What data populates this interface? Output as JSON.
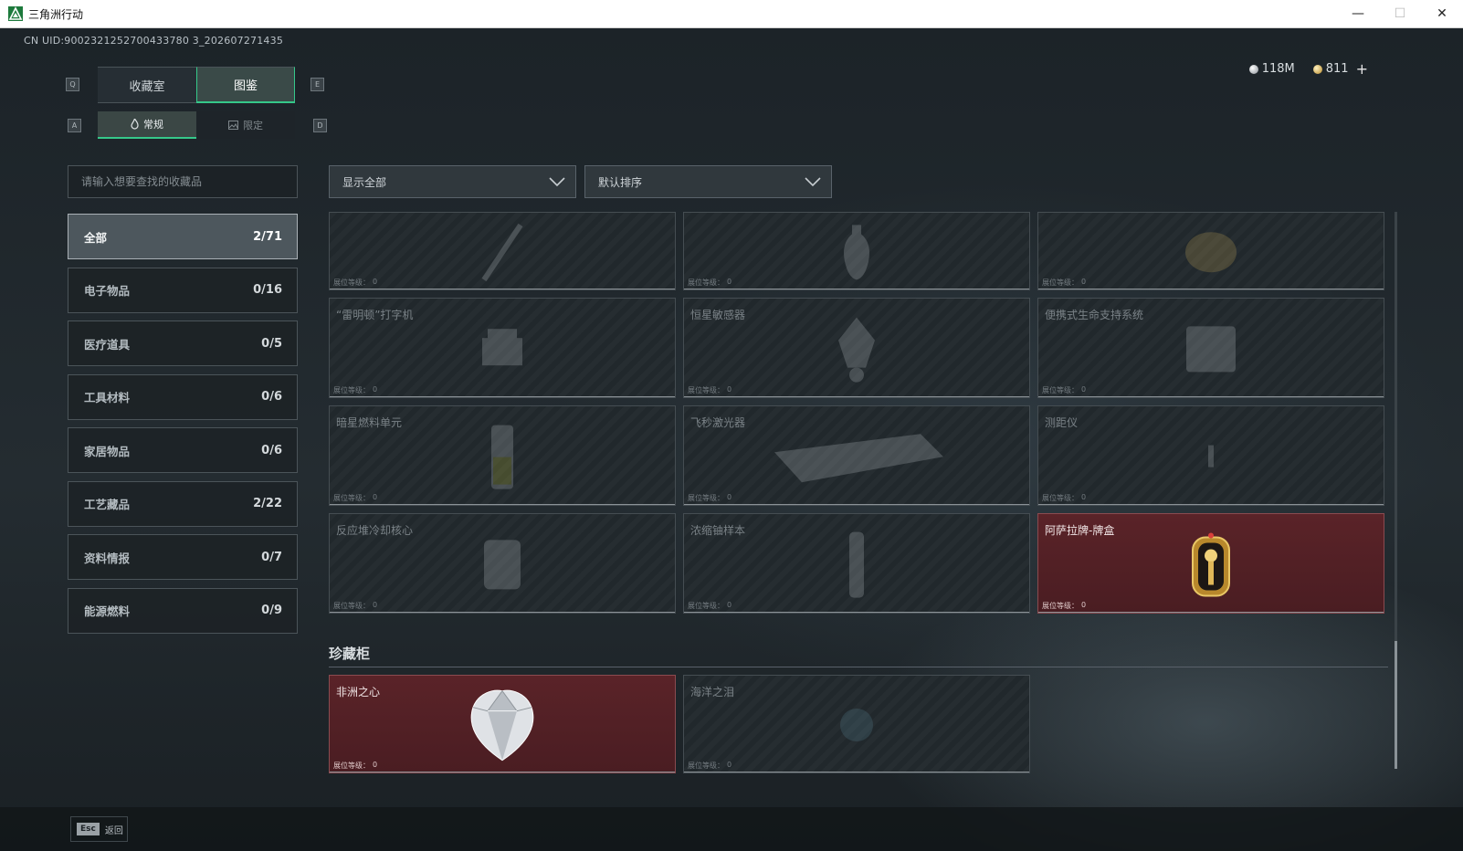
{
  "window": {
    "title": "三角洲行动",
    "minimize": "—",
    "maximize": "☐",
    "close": "✕"
  },
  "uid": "CN UID:9002321252700433780 3_202607271435",
  "currency": {
    "silver": "118M",
    "gold": "811",
    "add": "+"
  },
  "key_hints": {
    "prev_tab": "Q",
    "next_tab": "E",
    "prev_sub": "A",
    "next_sub": "D"
  },
  "main_tabs": [
    {
      "label": "收藏室"
    },
    {
      "label": "图鉴"
    }
  ],
  "sub_tabs": [
    {
      "label": "常规"
    },
    {
      "label": "限定"
    }
  ],
  "search": {
    "placeholder": "请输入想要查找的收藏品"
  },
  "filters": {
    "show": "显示全部",
    "sort": "默认排序"
  },
  "categories": [
    {
      "label": "全部",
      "count": "2/71"
    },
    {
      "label": "电子物品",
      "count": "0/16"
    },
    {
      "label": "医疗道具",
      "count": "0/5"
    },
    {
      "label": "工具材料",
      "count": "0/6"
    },
    {
      "label": "家居物品",
      "count": "0/6"
    },
    {
      "label": "工艺藏品",
      "count": "2/22"
    },
    {
      "label": "资料情报",
      "count": "0/7"
    },
    {
      "label": "能源燃料",
      "count": "0/9"
    }
  ],
  "level_label": "展位等级：",
  "cards": [
    {
      "name": "",
      "level": "0",
      "owned": false,
      "icon": "screwdriver-icon"
    },
    {
      "name": "",
      "level": "0",
      "owned": false,
      "icon": "vase-icon"
    },
    {
      "name": "",
      "level": "0",
      "owned": false,
      "icon": "figurine-icon"
    },
    {
      "name": "“雷明顿”打字机",
      "level": "0",
      "owned": false,
      "icon": "typewriter-icon"
    },
    {
      "name": "恒星敏感器",
      "level": "0",
      "owned": false,
      "icon": "sensor-icon"
    },
    {
      "name": "便携式生命支持系统",
      "level": "0",
      "owned": false,
      "icon": "life-support-icon"
    },
    {
      "name": "暗星燃料单元",
      "level": "0",
      "owned": false,
      "icon": "fuel-cell-icon"
    },
    {
      "name": "飞秒激光器",
      "level": "0",
      "owned": false,
      "icon": "laser-icon"
    },
    {
      "name": "测距仪",
      "level": "0",
      "owned": false,
      "icon": "rangefinder-icon"
    },
    {
      "name": "反应堆冷却核心",
      "level": "0",
      "owned": false,
      "icon": "reactor-core-icon"
    },
    {
      "name": "浓缩铀样本",
      "level": "0",
      "owned": false,
      "icon": "uranium-sample-icon"
    },
    {
      "name": "阿萨拉牌-牌盒",
      "level": "0",
      "owned": true,
      "icon": "card-box-icon"
    }
  ],
  "treasure_section": "珍藏柜",
  "treasure_cards": [
    {
      "name": "非洲之心",
      "level": "0",
      "owned": true,
      "icon": "diamond-icon"
    },
    {
      "name": "海洋之泪",
      "level": "0",
      "owned": false,
      "icon": "gem-icon"
    }
  ],
  "footer": {
    "esc_key": "Esc",
    "back": "返回"
  },
  "colors": {
    "accent": "#35c88a",
    "owned_bg": "#5a2328"
  }
}
